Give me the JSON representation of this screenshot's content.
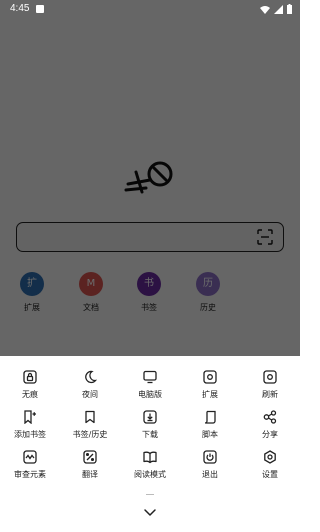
{
  "status": {
    "time": "4:45"
  },
  "shortcuts": [
    {
      "letter": "扩",
      "label": "扩展",
      "color": "#2f6fb0"
    },
    {
      "letter": "M",
      "label": "文档",
      "color": "#d9534f"
    },
    {
      "letter": "书",
      "label": "书签",
      "color": "#6a2ba0"
    },
    {
      "letter": "历",
      "label": "历史",
      "color": "#8a6fc4"
    }
  ],
  "menu": [
    {
      "label": "无痕",
      "icon": "lock-icon"
    },
    {
      "label": "夜间",
      "icon": "moon-icon"
    },
    {
      "label": "电脑版",
      "icon": "monitor-icon"
    },
    {
      "label": "扩展",
      "icon": "extension-icon"
    },
    {
      "label": "刷新",
      "icon": "refresh-icon"
    },
    {
      "label": "添加书签",
      "icon": "bookmark-add-icon"
    },
    {
      "label": "书签/历史",
      "icon": "bookmark-icon"
    },
    {
      "label": "下载",
      "icon": "download-icon"
    },
    {
      "label": "脚本",
      "icon": "script-icon"
    },
    {
      "label": "分享",
      "icon": "share-icon"
    },
    {
      "label": "审查元素",
      "icon": "inspect-icon"
    },
    {
      "label": "翻译",
      "icon": "translate-icon"
    },
    {
      "label": "阅读模式",
      "icon": "book-icon"
    },
    {
      "label": "退出",
      "icon": "power-icon"
    },
    {
      "label": "设置",
      "icon": "settings-icon"
    }
  ]
}
